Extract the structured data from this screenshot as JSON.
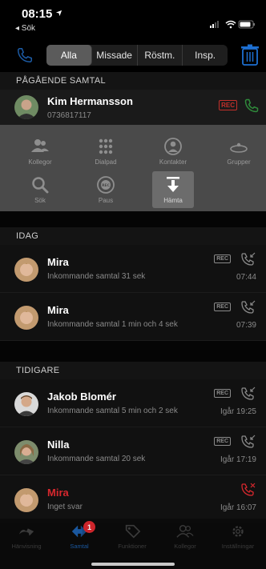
{
  "status_bar": {
    "time": "08:15",
    "back_label": "◂ Sök"
  },
  "filter": {
    "tabs": [
      "Alla",
      "Missade",
      "Röstm.",
      "Insp."
    ],
    "active": "Alla"
  },
  "active_call": {
    "section_title": "PÅGÅENDE SAMTAL",
    "name": "Kim Hermansson",
    "number": "0736817117",
    "rec_label": "REC"
  },
  "actions": [
    {
      "label": "Kollegor",
      "icon": "colleagues-icon"
    },
    {
      "label": "Dialpad",
      "icon": "dialpad-icon"
    },
    {
      "label": "Kontakter",
      "icon": "contacts-icon"
    },
    {
      "label": "Grupper",
      "icon": "groups-icon"
    },
    {
      "label": "Sök",
      "icon": "search-icon"
    },
    {
      "label": "Paus",
      "icon": "pause-rec-icon"
    },
    {
      "label": "Hämta",
      "icon": "fetch-icon"
    }
  ],
  "today": {
    "section_title": "IDAG",
    "calls": [
      {
        "name": "Mira",
        "detail": "Inkommande samtal 31 sek",
        "time": "07:44",
        "rec": "REC"
      },
      {
        "name": "Mira",
        "detail": "Inkommande samtal 1 min och 4 sek",
        "time": "07:39",
        "rec": "REC"
      }
    ]
  },
  "earlier": {
    "section_title": "TIDIGARE",
    "calls": [
      {
        "name": "Jakob Blomér",
        "detail": "Inkommande samtal 5 min och 2 sek",
        "time": "Igår 19:25",
        "rec": "REC"
      },
      {
        "name": "Nilla",
        "detail": "Inkommande samtal 20 sek",
        "time": "Igår 17:19",
        "rec": "REC"
      },
      {
        "name": "Mira",
        "detail": "Inget svar",
        "time": "Igår 16:07"
      }
    ]
  },
  "tabbar": {
    "tabs": [
      {
        "label": "Hänvisning",
        "icon": "redirect-icon"
      },
      {
        "label": "Samtal",
        "icon": "calls-icon",
        "badge": "1"
      },
      {
        "label": "Funktioner",
        "icon": "functions-icon"
      },
      {
        "label": "Kollegor",
        "icon": "colleagues-icon"
      },
      {
        "label": "Inställningar",
        "icon": "settings-icon"
      }
    ],
    "active": "Samtal"
  },
  "colors": {
    "accent": "#1d5da8",
    "missed": "#d8282e",
    "rec_active": "#c2302b",
    "answer": "#2f8a3b"
  }
}
